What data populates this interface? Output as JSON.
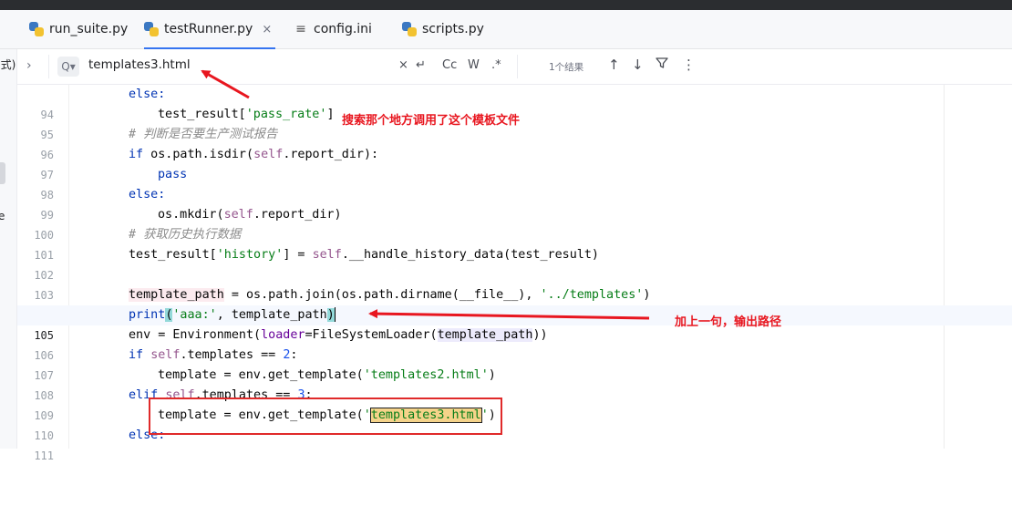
{
  "tabs": [
    {
      "label": "run_suite.py",
      "icon": "python-file-icon",
      "active": false
    },
    {
      "label": "testRunner.py",
      "icon": "python-file-icon",
      "active": true,
      "close": "×"
    },
    {
      "label": "config.ini",
      "icon": "ini-file-icon",
      "active": false
    },
    {
      "label": "scripts.py",
      "icon": "python-file-icon",
      "active": false
    }
  ],
  "left_panel": {
    "fragment_1": "(式)",
    "fragment_2": "e"
  },
  "search": {
    "query": "templates3.html",
    "buttons": [
      "×",
      "↵",
      "Cc",
      "W",
      ".*"
    ],
    "result_count": "1个结果",
    "nav": [
      "↑",
      "↓",
      "filter",
      "⋮"
    ]
  },
  "line_numbers": [
    "94",
    "95",
    "96",
    "97",
    "98",
    "99",
    "100",
    "101",
    "102",
    "103",
    "104",
    "105",
    "106",
    "107",
    "108",
    "109",
    "110",
    "111"
  ],
  "current_line": "105",
  "annotations": {
    "search_note": "搜索那个地方调用了这个模板文件",
    "print_note": "加上一句，输出路径"
  },
  "colors": {
    "annotation": "#e8161f",
    "keyword": "#0033b3",
    "string": "#067d17",
    "self": "#94558d",
    "active_tab_underline": "#3574f0"
  },
  "code": {
    "l94": "else:",
    "l95_a": "test_result[",
    "l95_s": "'pass_rate'",
    "l95_b": "]",
    "l96": "# 判断是否要生产测试报告",
    "l97_kw": "if",
    "l97_a": " os.path.isdir(",
    "l97_self": "self",
    "l97_b": ".report_dir):",
    "l98": "pass",
    "l99": "else:",
    "l100_a": "os.mkdir(",
    "l100_self": "self",
    "l100_b": ".report_dir)",
    "l101": "# 获取历史执行数据",
    "l102_a": "test_result[",
    "l102_s": "'history'",
    "l102_b": "] = ",
    "l102_self": "self",
    "l102_c": ".__handle_history_data(test_result)",
    "l104_var": "template_path",
    "l104_a": " = os.path.join(os.path.dirname(__file__), ",
    "l104_s": "'../templates'",
    "l104_b": ")",
    "l105_fn": "print",
    "l105_p1": "(",
    "l105_s": "'aaa:'",
    "l105_a": ", template_path",
    "l105_p2": ")",
    "l106_a": "env = Environment(",
    "l106_kw": "loader",
    "l106_b": "=FileSystemLoader(",
    "l106_c": "template_path",
    "l106_d": "))",
    "l107_kw": "if",
    "l107_self": "self",
    "l107_a": ".templates == ",
    "l107_n": "2",
    "l107_b": ":",
    "l108_a": "template = env.get_template(",
    "l108_s": "'templates2.html'",
    "l108_b": ")",
    "l109_kw": "elif",
    "l109_self": "self",
    "l109_a": ".templates == ",
    "l109_n": "3",
    "l109_b": ":",
    "l110_a": "template = env.get_template(",
    "l110_q1": "'",
    "l110_m": "templates3.html",
    "l110_q2": "'",
    "l110_b": ")",
    "l111": "else:"
  }
}
